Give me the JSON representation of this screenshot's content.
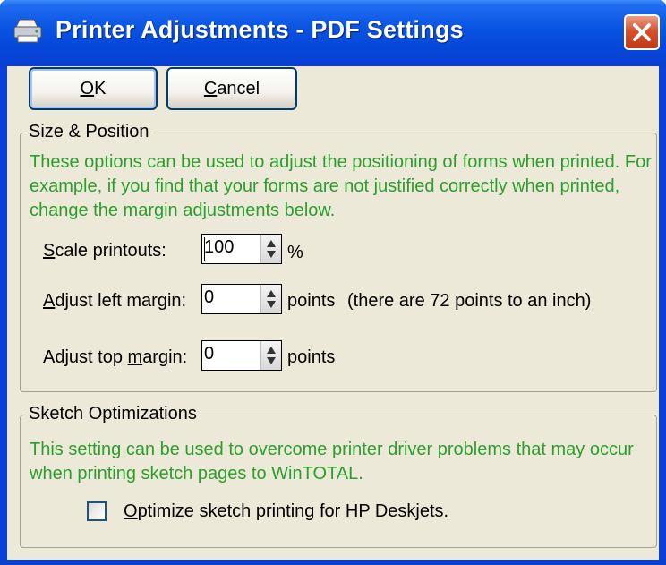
{
  "window": {
    "title": "Printer Adjustments - PDF Settings"
  },
  "buttons": {
    "ok_prefix": "",
    "ok_mnemonic": "O",
    "ok_rest": "K",
    "cancel_mnemonic": "C",
    "cancel_rest": "ancel"
  },
  "size_position": {
    "legend": "Size & Position",
    "description": "These options can be used to adjust the positioning of forms when printed. For example, if you find that your forms are not justified correctly when printed, change the margin adjustments below.",
    "scale": {
      "label_mnemonic": "S",
      "label_rest": "cale printouts:",
      "value": "100",
      "unit": "%"
    },
    "left_margin": {
      "label_mnemonic": "A",
      "label_rest": "djust left margin:",
      "value": "0",
      "unit": "points",
      "hint": "(there are 72 points to an inch)"
    },
    "top_margin": {
      "label_prefix": "Adjust top ",
      "label_mnemonic": "m",
      "label_rest": "argin:",
      "value": "0",
      "unit": "points"
    }
  },
  "sketch": {
    "legend": "Sketch Optimizations",
    "description": "This setting can be used to overcome printer driver problems that may occur when printing sketch pages to WinTOTAL.",
    "checkbox": {
      "mnemonic": "O",
      "rest": "ptimize sketch printing for HP Deskjets.",
      "checked": false
    }
  },
  "colors": {
    "description_text": "#2c9e2c",
    "titlebar": "#0a55e3",
    "dialog_bg": "#ece9d8"
  }
}
